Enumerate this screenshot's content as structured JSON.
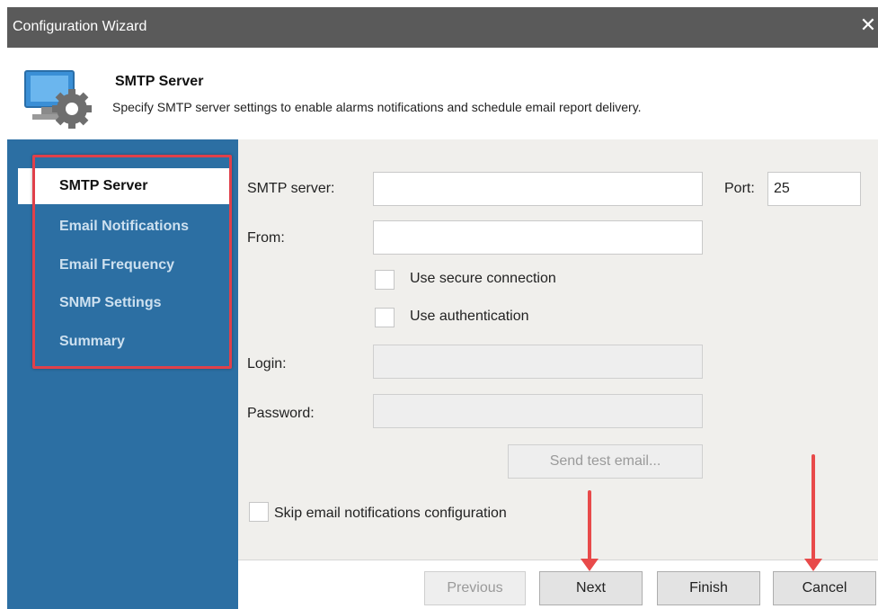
{
  "window": {
    "title": "Configuration Wizard",
    "close_glyph": "✕"
  },
  "header": {
    "icon": "computer-gear-icon",
    "title": "SMTP Server",
    "subtitle": "Specify SMTP server settings to enable alarms notifications and schedule email report delivery."
  },
  "sidebar": {
    "items": [
      {
        "label": "SMTP Server",
        "active": true
      },
      {
        "label": "Email Notifications",
        "active": false
      },
      {
        "label": "Email Frequency",
        "active": false
      },
      {
        "label": "SNMP Settings",
        "active": false
      },
      {
        "label": "Summary",
        "active": false
      }
    ]
  },
  "form": {
    "smtp_server_label": "SMTP server:",
    "smtp_server_value": "",
    "port_label": "Port:",
    "port_value": "25",
    "from_label": "From:",
    "from_value": "",
    "secure_label": "Use secure connection",
    "auth_label": "Use authentication",
    "login_label": "Login:",
    "login_value": "",
    "password_label": "Password:",
    "password_value": "",
    "test_button": "Send test email...",
    "skip_label": "Skip email notifications configuration"
  },
  "footer": {
    "previous": "Previous",
    "next": "Next",
    "finish": "Finish",
    "cancel": "Cancel"
  },
  "colors": {
    "titlebar": "#5a5a5a",
    "sidebar": "#2c6fa3",
    "highlight": "#e0404a"
  }
}
